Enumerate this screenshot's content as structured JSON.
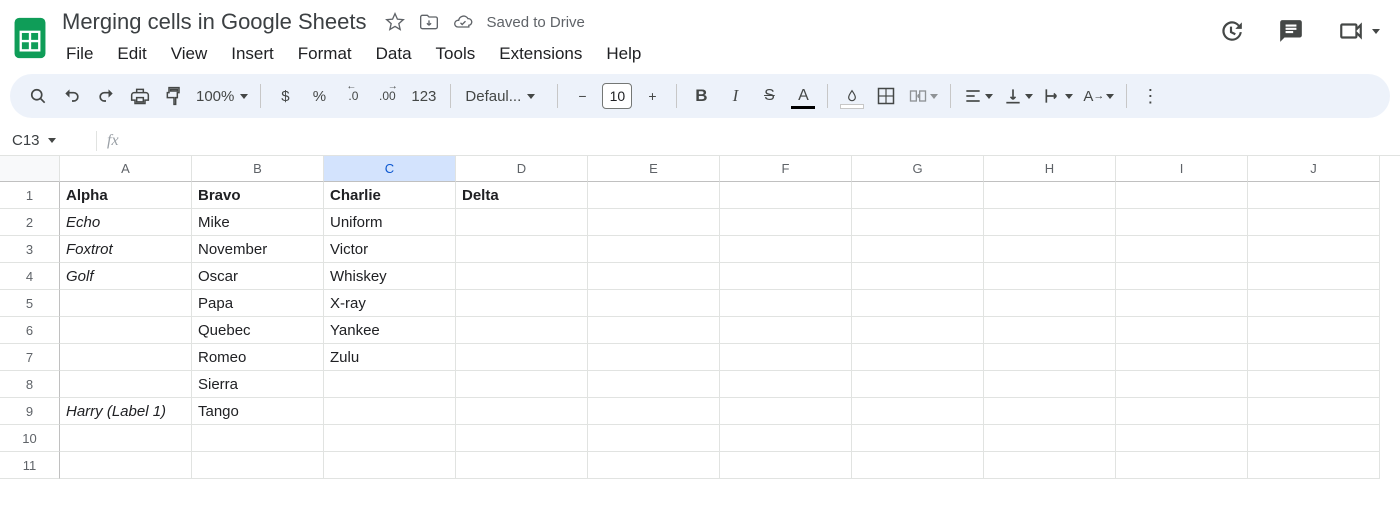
{
  "doc_title": "Merging cells in Google Sheets",
  "saved_text": "Saved to Drive",
  "menus": [
    "File",
    "Edit",
    "View",
    "Insert",
    "Format",
    "Data",
    "Tools",
    "Extensions",
    "Help"
  ],
  "toolbar": {
    "zoom": "100%",
    "currency": "$",
    "percent": "%",
    "dec_dec": ".0",
    "inc_dec": ".00",
    "num123": "123",
    "font_name": "Defaul...",
    "font_size": "10",
    "minus": "−",
    "plus": "+"
  },
  "namebox": "C13",
  "columns": [
    "A",
    "B",
    "C",
    "D",
    "E",
    "F",
    "G",
    "H",
    "I",
    "J"
  ],
  "selected_col_index": 2,
  "row_count": 11,
  "chart_data": {
    "type": "table",
    "headers": [
      "Alpha",
      "Bravo",
      "Charlie",
      "Delta"
    ],
    "rows": [
      [
        "Echo",
        "Mike",
        "Uniform",
        ""
      ],
      [
        "Foxtrot",
        "November",
        "Victor",
        ""
      ],
      [
        "Golf",
        "Oscar",
        "Whiskey",
        ""
      ],
      [
        "",
        "Papa",
        "X-ray",
        ""
      ],
      [
        "",
        "Quebec",
        "Yankee",
        ""
      ],
      [
        "",
        "Romeo",
        "Zulu",
        ""
      ],
      [
        "",
        "Sierra",
        "",
        ""
      ],
      [
        "Harry (Label 1)",
        "Tango",
        "",
        ""
      ]
    ],
    "bold_row": 0,
    "italic_col": 0
  }
}
